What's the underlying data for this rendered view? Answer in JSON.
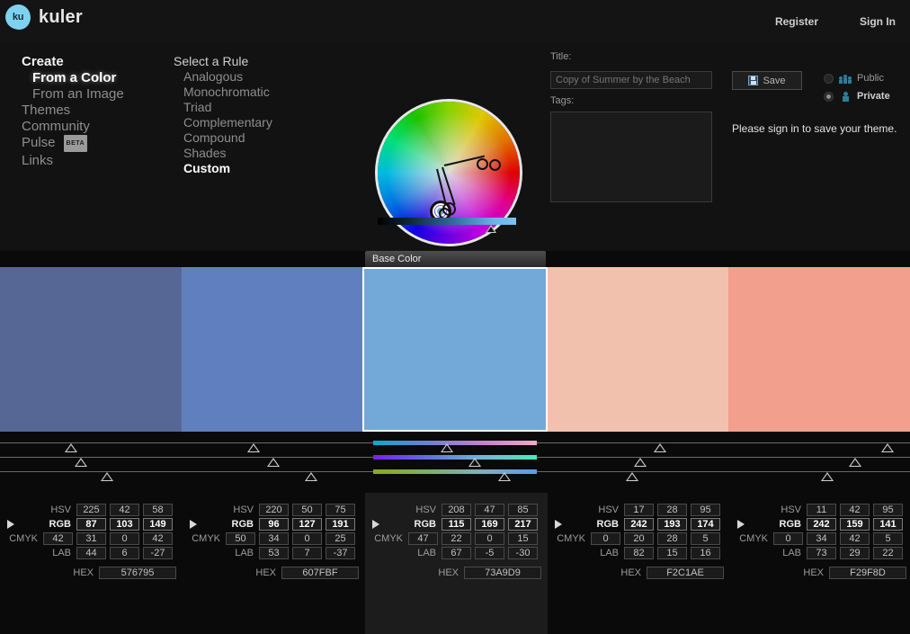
{
  "header": {
    "logo_mark": "ku",
    "logo_text": "kuler",
    "register": "Register",
    "signin": "Sign In"
  },
  "nav": {
    "items": [
      {
        "label": "Create",
        "style": "strong"
      },
      {
        "label": "From a Color",
        "style": "sub sel"
      },
      {
        "label": "From an Image",
        "style": "sub"
      },
      {
        "label": "Themes",
        "style": ""
      },
      {
        "label": "Community",
        "style": ""
      },
      {
        "label": "Pulse",
        "style": "",
        "badge": "BETA"
      },
      {
        "label": "Links",
        "style": ""
      }
    ]
  },
  "rules": {
    "title": "Select a Rule",
    "items": [
      {
        "label": "Analogous",
        "selected": false
      },
      {
        "label": "Monochromatic",
        "selected": false
      },
      {
        "label": "Triad",
        "selected": false
      },
      {
        "label": "Complementary",
        "selected": false
      },
      {
        "label": "Compound",
        "selected": false
      },
      {
        "label": "Shades",
        "selected": false
      },
      {
        "label": "Custom",
        "selected": true
      }
    ]
  },
  "save_panel": {
    "title_label": "Title:",
    "title_placeholder": "Copy of Summer by the Beach",
    "title_value": "",
    "tags_label": "Tags:",
    "tags_value": "",
    "save_label": "Save",
    "public_label": "Public",
    "private_label": "Private",
    "privacy_selected": "Private",
    "signin_message": "Please sign in to save your theme."
  },
  "wheel": {
    "brightness_percent": 82
  },
  "swatch_band": {
    "base_tab_label": "Base Color",
    "selected_index": 2
  },
  "labels": {
    "hsv": "HSV",
    "rgb": "RGB",
    "cmyk": "CMYK",
    "lab": "LAB",
    "hex": "HEX"
  },
  "swatches": [
    {
      "name": "swatch-1",
      "hex_color": "#576795",
      "selected": false,
      "hsv": [
        "225",
        "42",
        "58"
      ],
      "rgb": [
        "87",
        "103",
        "149"
      ],
      "cmyk": [
        "42",
        "31",
        "0",
        "42"
      ],
      "lab": [
        "44",
        "6",
        "-27"
      ],
      "hex": "576795",
      "slider_positions": [
        38,
        44,
        60
      ]
    },
    {
      "name": "swatch-2",
      "hex_color": "#607FBF",
      "selected": false,
      "hsv": [
        "220",
        "50",
        "75"
      ],
      "rgb": [
        "96",
        "127",
        "191"
      ],
      "cmyk": [
        "50",
        "34",
        "0",
        "25"
      ],
      "lab": [
        "53",
        "7",
        "-37"
      ],
      "hex": "607FBF",
      "slider_positions": [
        38,
        50,
        73
      ]
    },
    {
      "name": "swatch-3",
      "hex_color": "#73A9D9",
      "selected": true,
      "hsv": [
        "208",
        "47",
        "85"
      ],
      "rgb": [
        "115",
        "169",
        "217"
      ],
      "cmyk": [
        "47",
        "22",
        "0",
        "15"
      ],
      "lab": [
        "67",
        "-5",
        "-30"
      ],
      "hex": "73A9D9",
      "slider_positions": [
        45,
        62,
        80
      ]
    },
    {
      "name": "swatch-4",
      "hex_color": "#F2C1AE",
      "selected": false,
      "hsv": [
        "17",
        "28",
        "95"
      ],
      "rgb": [
        "242",
        "193",
        "174"
      ],
      "cmyk": [
        "0",
        "20",
        "28",
        "5"
      ],
      "lab": [
        "82",
        "15",
        "16"
      ],
      "hex": "F2C1AE",
      "slider_positions": [
        64,
        52,
        47
      ]
    },
    {
      "name": "swatch-5",
      "hex_color": "#F29F8D",
      "selected": false,
      "hsv": [
        "11",
        "42",
        "95"
      ],
      "rgb": [
        "242",
        "159",
        "141"
      ],
      "cmyk": [
        "0",
        "34",
        "42",
        "5"
      ],
      "lab": [
        "73",
        "29",
        "22"
      ],
      "hex": "F29F8D",
      "slider_positions": [
        92,
        72,
        55
      ]
    }
  ]
}
